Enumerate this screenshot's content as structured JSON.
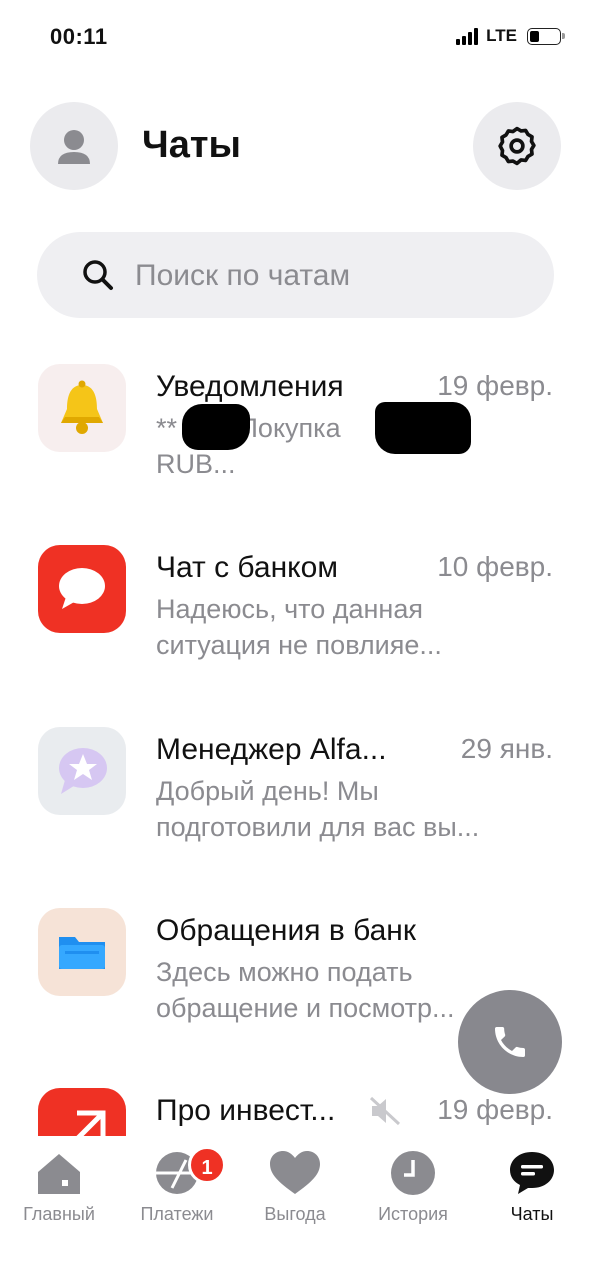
{
  "status_bar": {
    "time": "00:11",
    "network": "LTE"
  },
  "header": {
    "title": "Чаты",
    "avatar_icon": "person-icon",
    "settings_icon": "gear-icon"
  },
  "search": {
    "placeholder": "Поиск по чатам"
  },
  "chats": [
    {
      "name": "Уведомления",
      "date": "19 февр.",
      "preview": "**   Покупка    RUB...",
      "icon": "bell-icon"
    },
    {
      "name": "Чат с банком",
      "date": "10 февр.",
      "preview": "Надеюсь, что данная ситуация не повлияе...",
      "icon": "speech-bubble-icon"
    },
    {
      "name": "Менеджер Alfa...",
      "date": "29 янв.",
      "preview": "Добрый день! Мы подготовили для вас вы...",
      "icon": "star-bubble-icon"
    },
    {
      "name": "Обращения в банк",
      "date": "",
      "preview": "Здесь можно подать обращение и посмотр...",
      "icon": "folder-icon"
    },
    {
      "name": "Про инвест...",
      "date": "19 февр.",
      "preview": "",
      "icon": "invest-icon",
      "muted": true
    }
  ],
  "tabbar": {
    "items": [
      {
        "label": "Главный",
        "icon": "home-icon"
      },
      {
        "label": "Платежи",
        "icon": "payments-icon",
        "badge": "1"
      },
      {
        "label": "Выгода",
        "icon": "heart-icon"
      },
      {
        "label": "История",
        "icon": "clock-icon"
      },
      {
        "label": "Чаты",
        "icon": "chat-icon",
        "active": true
      }
    ]
  },
  "colors": {
    "accent_red": "#ef3124",
    "muted_text": "#8b8b90",
    "fab": "#88888e"
  }
}
